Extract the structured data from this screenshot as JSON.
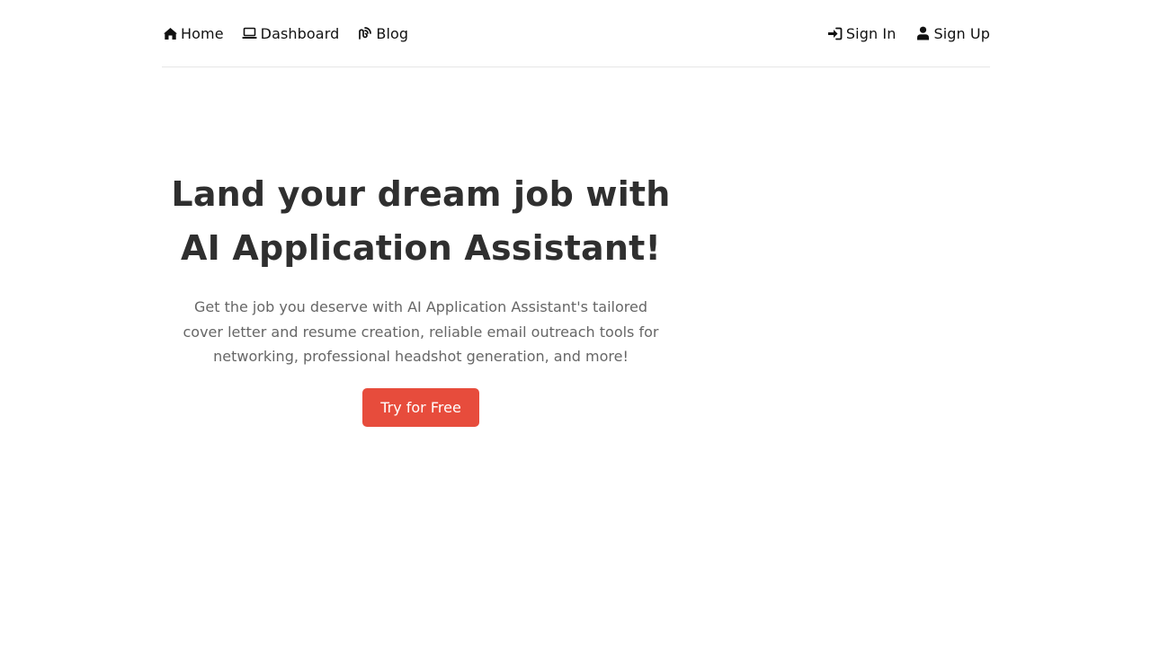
{
  "nav": {
    "left": [
      {
        "label": "Home",
        "icon": "home-icon"
      },
      {
        "label": "Dashboard",
        "icon": "laptop-icon"
      },
      {
        "label": "Blog",
        "icon": "blog-icon"
      }
    ],
    "right": [
      {
        "label": "Sign In",
        "icon": "sign-in-icon"
      },
      {
        "label": "Sign Up",
        "icon": "user-icon"
      }
    ]
  },
  "hero": {
    "title_line1": "Land your dream job with",
    "title_line2": "AI Application Assistant!",
    "subtitle": "Get the job you deserve with AI Application Assistant's tailored cover letter and resume creation, reliable email outreach tools for networking, professional headshot generation, and more!",
    "cta_label": "Try for Free"
  },
  "colors": {
    "accent": "#e74c3c",
    "title_text": "#2f2f2f",
    "body_text": "#666666",
    "nav_text": "#111111",
    "divider": "#e6e6e6"
  }
}
